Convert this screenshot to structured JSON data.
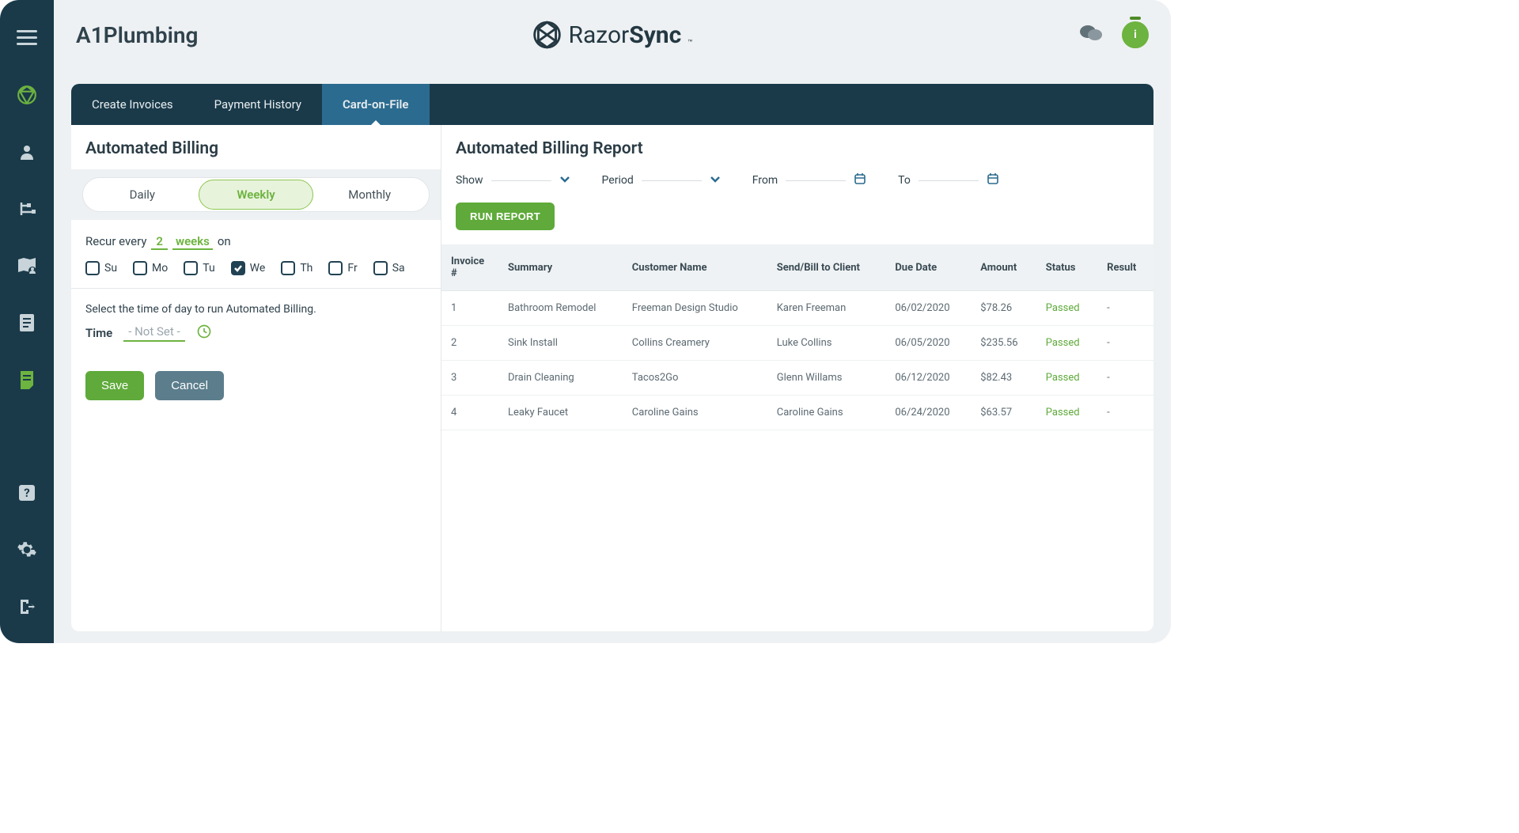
{
  "header": {
    "company": "A1Plumbing",
    "brand_left": "Razor",
    "brand_right": "Sync",
    "brand_tm": "™",
    "user_initial": "i"
  },
  "tabs": [
    {
      "label": "Create Invoices",
      "active": false
    },
    {
      "label": "Payment History",
      "active": false
    },
    {
      "label": "Card-on-File",
      "active": true
    }
  ],
  "billing": {
    "title": "Automated Billing",
    "frequency": {
      "options": [
        "Daily",
        "Weekly",
        "Monthly"
      ],
      "selected": "Weekly"
    },
    "recur_label": "Recur every",
    "recur_value": "2",
    "recur_unit": "weeks",
    "recur_suffix": "on",
    "days": [
      {
        "code": "Su",
        "checked": false
      },
      {
        "code": "Mo",
        "checked": false
      },
      {
        "code": "Tu",
        "checked": false
      },
      {
        "code": "We",
        "checked": true
      },
      {
        "code": "Th",
        "checked": false
      },
      {
        "code": "Fr",
        "checked": false
      },
      {
        "code": "Sa",
        "checked": false
      }
    ],
    "time_desc": "Select the time of day to run Automated Billing.",
    "time_label": "Time",
    "time_value": "- Not Set -",
    "save_label": "Save",
    "cancel_label": "Cancel"
  },
  "report": {
    "title": "Automated Billing Report",
    "filters": {
      "show_label": "Show",
      "period_label": "Period",
      "from_label": "From",
      "to_label": "To"
    },
    "run_label": "RUN REPORT",
    "columns": [
      "Invoice #",
      "Summary",
      "Customer Name",
      "Send/Bill to Client",
      "Due Date",
      "Amount",
      "Status",
      "Result"
    ],
    "rows": [
      {
        "invoice": "1",
        "summary": "Bathroom Remodel",
        "customer": "Freeman Design Studio",
        "send": "Karen Freeman",
        "due": "06/02/2020",
        "amount": "$78.26",
        "status": "Passed",
        "result": "-"
      },
      {
        "invoice": "2",
        "summary": "Sink Install",
        "customer": "Collins Creamery",
        "send": "Luke Collins",
        "due": "06/05/2020",
        "amount": "$235.56",
        "status": "Passed",
        "result": "-"
      },
      {
        "invoice": "3",
        "summary": "Drain Cleaning",
        "customer": "Tacos2Go",
        "send": "Glenn Willams",
        "due": "06/12/2020",
        "amount": "$82.43",
        "status": "Passed",
        "result": "-"
      },
      {
        "invoice": "4",
        "summary": "Leaky Faucet",
        "customer": "Caroline Gains",
        "send": "Caroline Gains",
        "due": "06/24/2020",
        "amount": "$63.57",
        "status": "Passed",
        "result": "-"
      }
    ]
  }
}
